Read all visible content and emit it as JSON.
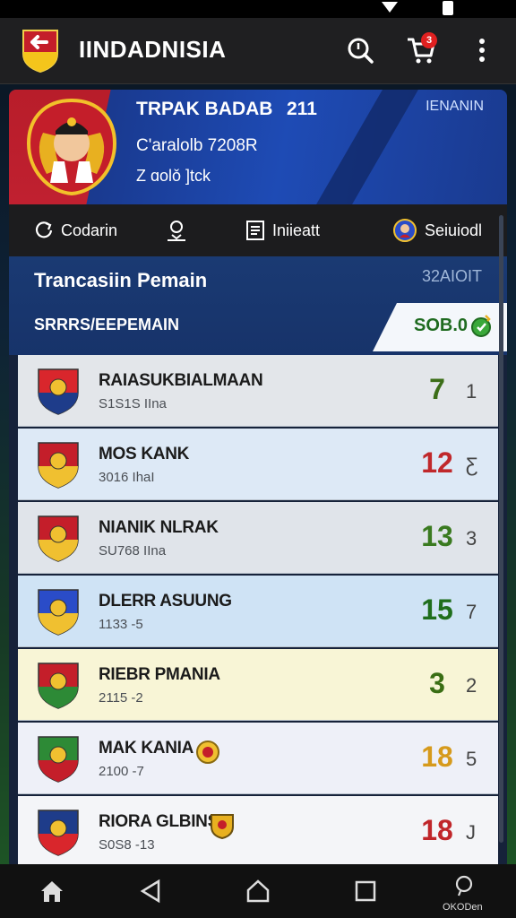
{
  "app": {
    "title": "IINDADNISIA",
    "cart_count": "3"
  },
  "hero": {
    "name": "TRPAK BADAB",
    "number": "211",
    "right_label": "IENANIN",
    "line1": "C'aralolb 7208R",
    "line2": "Z ɑolǒ ]tck"
  },
  "tabs": [
    {
      "label": "Codarin",
      "icon": "refresh-icon"
    },
    {
      "label": "",
      "icon": "user-pin-icon"
    },
    {
      "label": "Iniieatt",
      "icon": "document-icon"
    },
    {
      "label": "Seiuiodl",
      "icon": "badge-icon"
    }
  ],
  "section": {
    "title": "Trancasiin Pemain",
    "code": "32AIOIT",
    "subtitle": "SRRRS/EEPEMAIN",
    "pill_value": "SOB.0"
  },
  "rows": [
    {
      "name": "RAIASUKBIALMAAN",
      "sub": "S1S1S IIna",
      "score": "7",
      "rank": "1",
      "score_color": "#3c6e18",
      "bg": "#e3e6ea"
    },
    {
      "name": "MOS KANK",
      "sub": "3016 IhaI",
      "score": "12",
      "rank": "Ƹ",
      "score_color": "#c0282b",
      "bg": "#dde9f6"
    },
    {
      "name": "NIANIK NLRAK",
      "sub": "SU768 IIna",
      "score": "13",
      "rank": "3",
      "score_color": "#3a7a20",
      "bg": "#e0e4ea"
    },
    {
      "name": "DLERR ASUUNG",
      "sub": "1133 -5",
      "score": "15",
      "rank": "7",
      "score_color": "#1f6e1c",
      "bg": "#cfe3f5"
    },
    {
      "name": "RIEBR PMANIA",
      "sub": "2115 -2",
      "score": "3",
      "rank": "2",
      "score_color": "#3a6e14",
      "bg": "#f8f5d6"
    },
    {
      "name": "MAK KANIA",
      "sub": "2100 -7",
      "score": "18",
      "rank": "5",
      "score_color": "#d69a1c",
      "bg": "#eef0f8"
    },
    {
      "name": "RIORA GLBINS",
      "sub": "S0S8 -13",
      "score": "18",
      "rank": "J",
      "score_color": "#c0262a",
      "bg": "#f4f5f8"
    }
  ],
  "navbar": {
    "recent_label": "OKODen"
  }
}
